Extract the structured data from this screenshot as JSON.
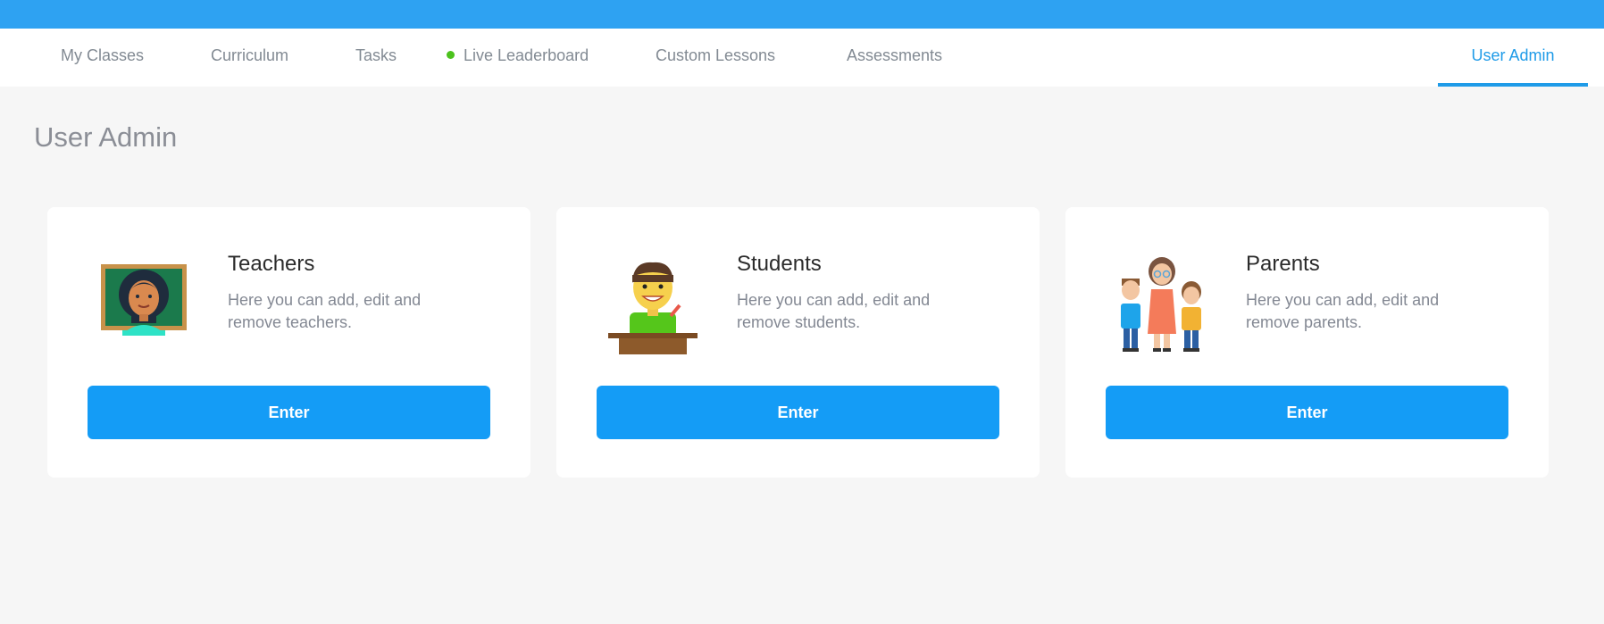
{
  "nav": {
    "items": [
      {
        "label": "My Classes"
      },
      {
        "label": "Curriculum"
      },
      {
        "label": "Tasks"
      },
      {
        "label": "Live Leaderboard",
        "live_indicator_color": "#4cc21d"
      },
      {
        "label": "Custom Lessons"
      },
      {
        "label": "Assessments"
      }
    ],
    "active": {
      "label": "User Admin"
    }
  },
  "page": {
    "title": "User Admin"
  },
  "cards": [
    {
      "title": "Teachers",
      "description": "Here you can add, edit and remove teachers.",
      "button": "Enter",
      "icon": "teacher-illustration"
    },
    {
      "title": "Students",
      "description": "Here you can add, edit and remove students.",
      "button": "Enter",
      "icon": "student-illustration"
    },
    {
      "title": "Parents",
      "description": "Here you can add, edit and remove parents.",
      "button": "Enter",
      "icon": "parents-illustration"
    }
  ],
  "colors": {
    "topbar": "#2ea2f2",
    "accent": "#1f9be8",
    "button": "#149cf6",
    "background": "#f6f6f6"
  }
}
